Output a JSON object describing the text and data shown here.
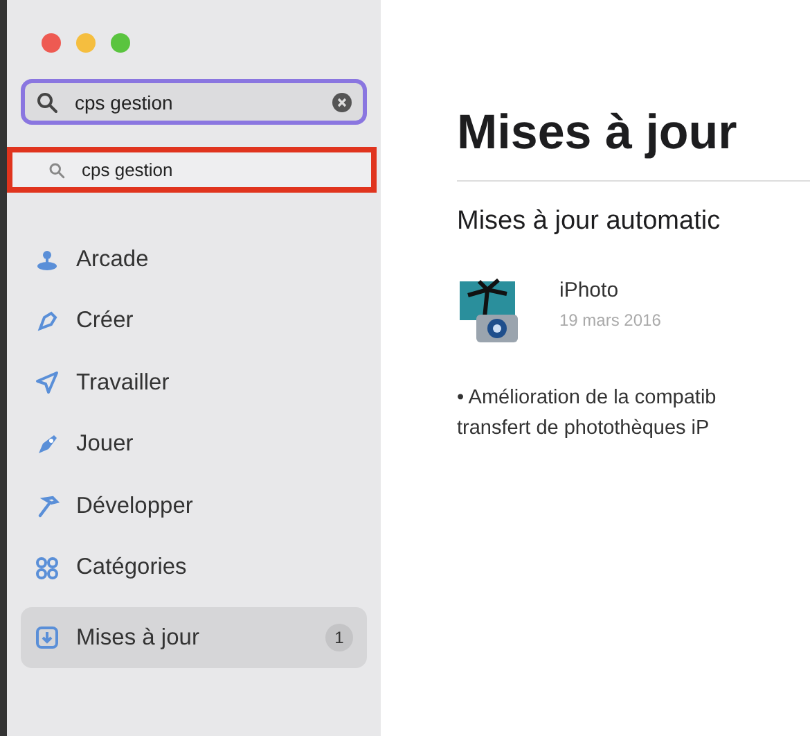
{
  "window": {
    "controls": [
      {
        "color": "#ee5a52"
      },
      {
        "color": "#f5be3f"
      },
      {
        "color": "#5ac43f"
      }
    ]
  },
  "search": {
    "value": "cps gestion"
  },
  "suggestion": {
    "label": "cps gestion",
    "highlighted": true
  },
  "sidebar": {
    "items": [
      {
        "label": "Arcade",
        "selected": false
      },
      {
        "label": "Créer",
        "selected": false
      },
      {
        "label": "Travailler",
        "selected": false
      },
      {
        "label": "Jouer",
        "selected": false
      },
      {
        "label": "Développer",
        "selected": false
      },
      {
        "label": "Catégories",
        "selected": false
      },
      {
        "label": "Mises à jour",
        "selected": true,
        "badge": "1"
      }
    ]
  },
  "main": {
    "title": "Mises à jour",
    "section": "Mises à jour automatic",
    "app": {
      "name": "iPhoto",
      "date": "19 mars 2016"
    },
    "notes": [
      "• Amélioration de la compatib",
      "transfert de photothèques iP"
    ]
  }
}
